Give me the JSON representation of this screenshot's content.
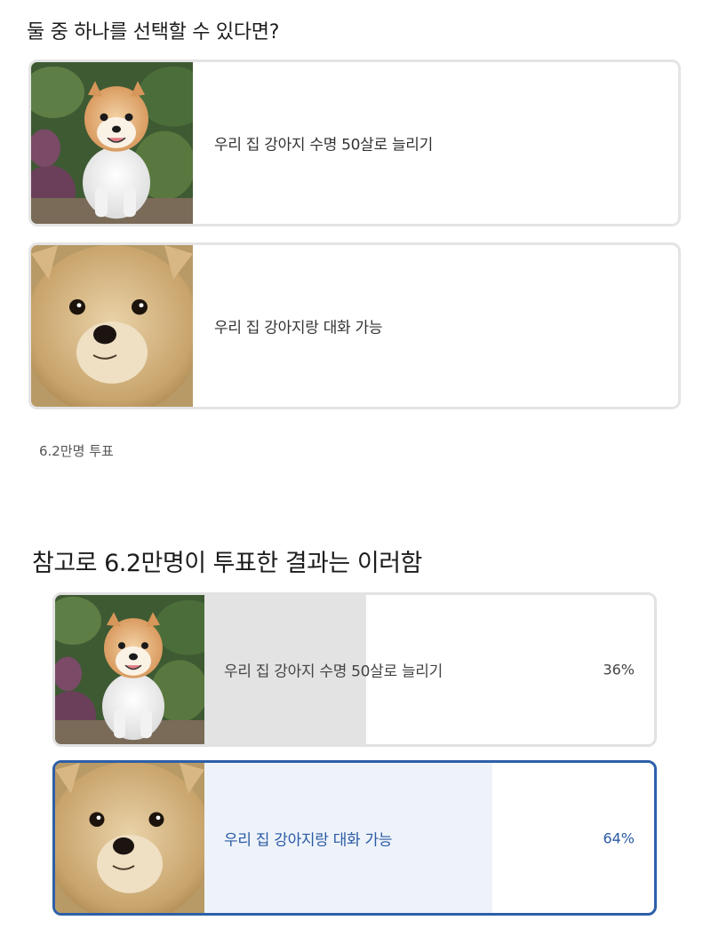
{
  "poll": {
    "question": "둘 중 하나를 선택할 수 있다면?",
    "options": [
      {
        "label": "우리 집 강아지 수명 50살로 늘리기",
        "image": "white-pomeranian-photo"
      },
      {
        "label": "우리 집 강아지랑 대화 가능",
        "image": "fluffy-pomeranian-face-photo"
      }
    ],
    "vote_count": "6.2만명 투표"
  },
  "results": {
    "title": "참고로 6.2만명이 투표한 결과는 이러함",
    "items": [
      {
        "label": "우리 집 강아지 수명 50살로 늘리기",
        "percent_label": "36%",
        "share": 0.36,
        "selected": false,
        "image": "white-pomeranian-photo"
      },
      {
        "label": "우리 집 강아지랑 대화 가능",
        "percent_label": "64%",
        "share": 0.64,
        "selected": true,
        "image": "fluffy-pomeranian-face-photo"
      }
    ]
  },
  "colors": {
    "selected_border": "#2d5fa8",
    "selected_text": "#2a5aa3",
    "selected_fill": "#eef3fa",
    "unselected_fill": "#e3e3e3",
    "card_border": "#e4e4e4"
  }
}
